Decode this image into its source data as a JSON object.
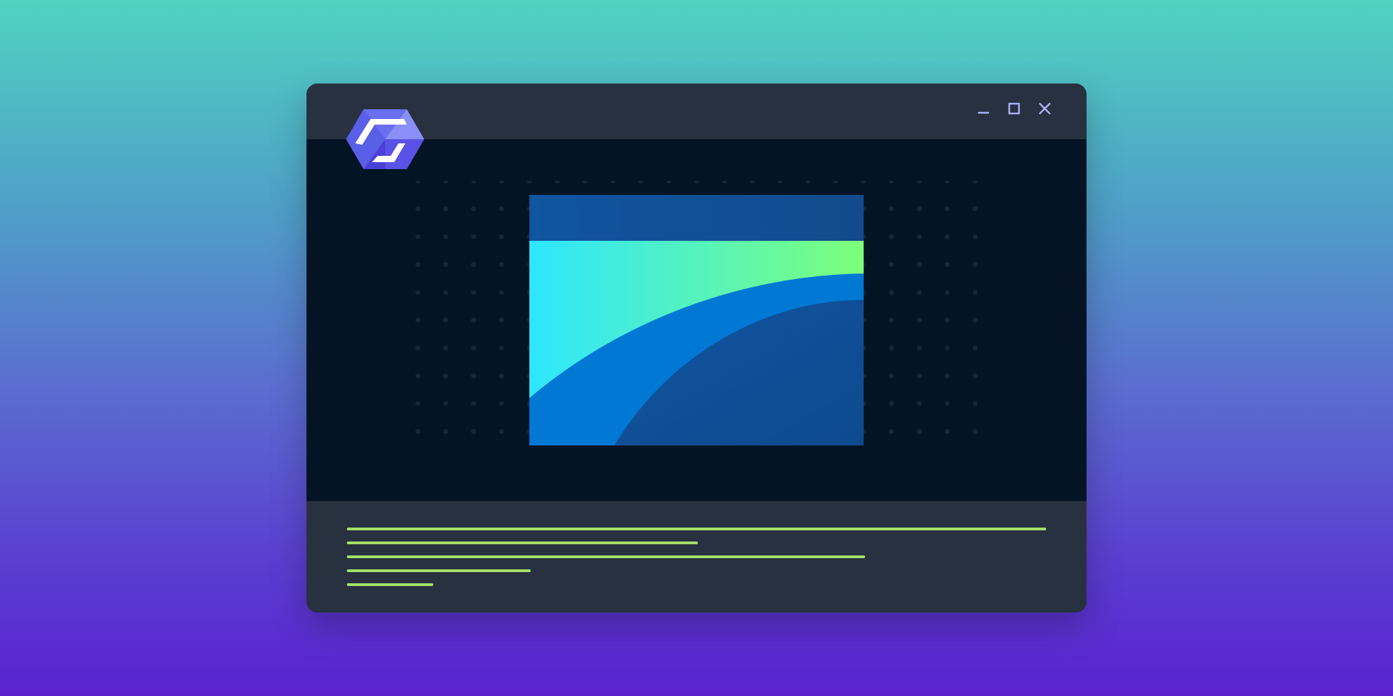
{
  "colors": {
    "background_top": "#4fd3c0",
    "background_bottom": "#5a22cf",
    "window_chrome": "#283140",
    "window_content": "#051424",
    "control_icon": "#a9b4ff",
    "logo_primary": "#6a6ff0",
    "logo_dark": "#4a3fd6",
    "image_top_band": "#0f4f96",
    "image_gradient_start": "#2ee6ff",
    "image_gradient_end": "#7dff7a",
    "image_wave": "#0078d4",
    "image_deep": "#0d4a8f",
    "code_lines": "#a3e06a"
  },
  "icons": {
    "logo": "hexagon-cube-logo-icon",
    "minimize": "minimize-icon",
    "maximize": "maximize-icon",
    "close": "close-icon",
    "image": "image-placeholder-icon"
  },
  "footer": {
    "code_line_count": 5
  }
}
